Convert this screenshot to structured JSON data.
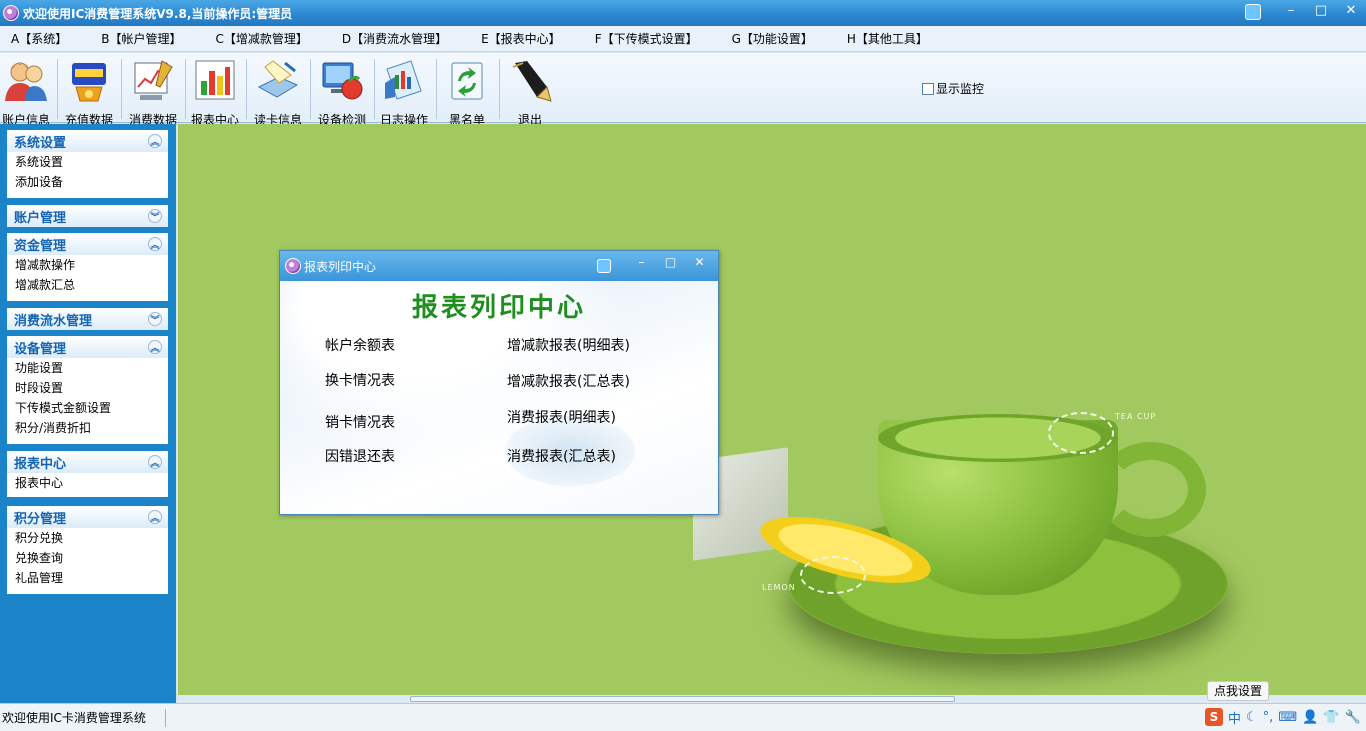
{
  "window": {
    "title": "欢迎使用IC消费管理系统V9.8,当前操作员:管理员",
    "controls": {
      "minimize": "–",
      "maximize": "□",
      "close": "✕"
    }
  },
  "menu": [
    "A【系统】",
    "B【帐户管理】",
    "C【增减款管理】",
    "D【消费流水管理】",
    "E【报表中心】",
    "F【下传模式设置】",
    "G【功能设置】",
    "H【其他工具】"
  ],
  "toolbar": {
    "tools": [
      {
        "label": "账户信息",
        "icon": "users-icon"
      },
      {
        "label": "充值数据",
        "icon": "recharge-icon"
      },
      {
        "label": "消费数据",
        "icon": "consumption-chart-icon"
      },
      {
        "label": "报表中心",
        "icon": "bar-chart-icon"
      },
      {
        "label": "读卡信息",
        "icon": "card-reader-icon"
      },
      {
        "label": "设备检测",
        "icon": "device-check-icon"
      },
      {
        "label": "日志操作",
        "icon": "log-icon"
      },
      {
        "label": "黑名单",
        "icon": "blacklist-icon"
      },
      {
        "label": "退出",
        "icon": "exit-pen-icon"
      }
    ],
    "monitor_label": "显示监控"
  },
  "sidebar": {
    "groups": [
      {
        "title": "系统设置",
        "expanded": true,
        "items": [
          "系统设置",
          "添加设备"
        ]
      },
      {
        "title": "账户管理",
        "expanded": false,
        "items": []
      },
      {
        "title": "资金管理",
        "expanded": true,
        "items": [
          "增减款操作",
          "增减款汇总"
        ]
      },
      {
        "title": "消费流水管理",
        "expanded": false,
        "items": []
      },
      {
        "title": "设备管理",
        "expanded": true,
        "items": [
          "功能设置",
          "时段设置",
          "下传模式金额设置",
          "积分/消费折扣"
        ]
      },
      {
        "title": "报表中心",
        "expanded": true,
        "items": [
          "报表中心"
        ]
      },
      {
        "title": "积分管理",
        "expanded": true,
        "items": [
          "积分兑换",
          "兑换查询",
          "礼品管理"
        ]
      }
    ]
  },
  "dialog": {
    "title": "报表列印中心",
    "heading": "报表列印中心",
    "reports_left": [
      "帐户余额表",
      "换卡情况表",
      "销卡情况表",
      "因错退还表"
    ],
    "reports_right": [
      "增减款报表(明细表)",
      "增减款报表(汇总表)",
      "消费报表(明细表)",
      "消费报表(汇总表)"
    ]
  },
  "wallpaper": {
    "text_top": "TEA CUP",
    "text_bottom": "LEMON"
  },
  "status": {
    "text": "欢迎使用IC卡消费管理系统",
    "ime_tip": "点我设置",
    "ime_mode": "中",
    "ime_logo": "S"
  },
  "colors": {
    "titlebar": "#2a86cf",
    "sidebar": "#1b84c9",
    "group_title": "#1565b3",
    "workspace": "#a2c95f",
    "dialog_heading": "#1e8f1e"
  }
}
